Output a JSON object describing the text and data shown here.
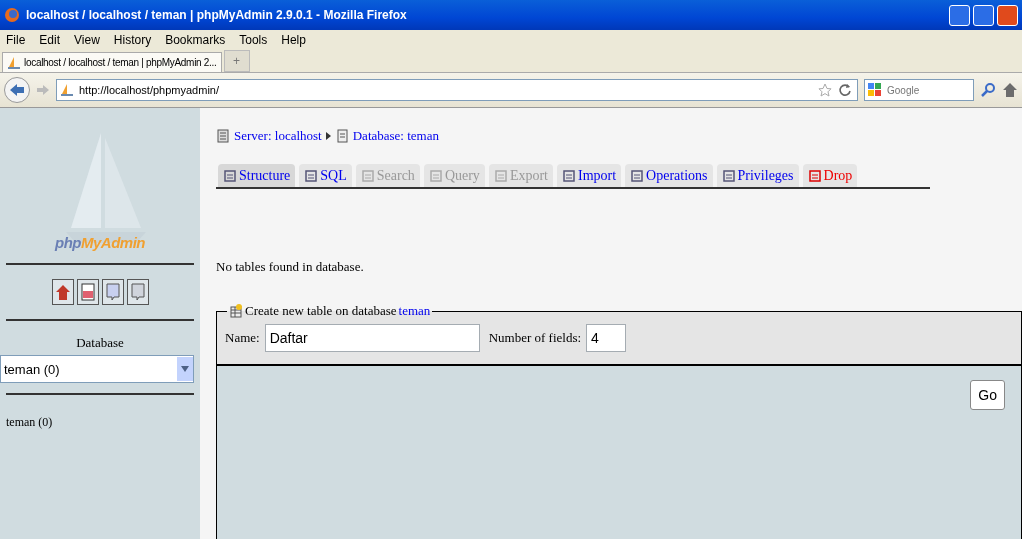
{
  "window": {
    "title": "localhost / localhost / teman | phpMyAdmin 2.9.0.1 - Mozilla Firefox"
  },
  "menu": [
    "File",
    "Edit",
    "View",
    "History",
    "Bookmarks",
    "Tools",
    "Help"
  ],
  "browser_tabs": [
    {
      "label": "localhost / localhost / teman | phpMyAdmin 2...",
      "selected": true
    }
  ],
  "new_tab": "+",
  "address": {
    "value": "http://localhost/phpmyadmin/"
  },
  "search": {
    "placeholder": "Google"
  },
  "sidebar": {
    "logo_prefix": "php",
    "logo_suffix": "MyAdmin",
    "database_label": "Database",
    "database_select": "teman (0)",
    "databases": [
      "teman (0)"
    ]
  },
  "breadcrumb": [
    {
      "label": "Server: localhost"
    },
    {
      "label": "Database: teman"
    }
  ],
  "tabs": [
    {
      "label": "Structure",
      "selected": true,
      "disabled": false,
      "kind": "normal"
    },
    {
      "label": "SQL",
      "selected": false,
      "disabled": false,
      "kind": "normal"
    },
    {
      "label": "Search",
      "selected": false,
      "disabled": true,
      "kind": "normal"
    },
    {
      "label": "Query",
      "selected": false,
      "disabled": true,
      "kind": "normal"
    },
    {
      "label": "Export",
      "selected": false,
      "disabled": true,
      "kind": "normal"
    },
    {
      "label": "Import",
      "selected": false,
      "disabled": false,
      "kind": "normal"
    },
    {
      "label": "Operations",
      "selected": false,
      "disabled": false,
      "kind": "normal"
    },
    {
      "label": "Privileges",
      "selected": false,
      "disabled": false,
      "kind": "normal"
    },
    {
      "label": "Drop",
      "selected": false,
      "disabled": false,
      "kind": "danger"
    }
  ],
  "message": "No tables found in database.",
  "create_table": {
    "legend": "Create new table on database",
    "database_link": "teman",
    "name_label": "Name:",
    "name_value": "Daftar",
    "fields_label": "Number of fields:",
    "fields_value": "4",
    "button": "Go"
  }
}
